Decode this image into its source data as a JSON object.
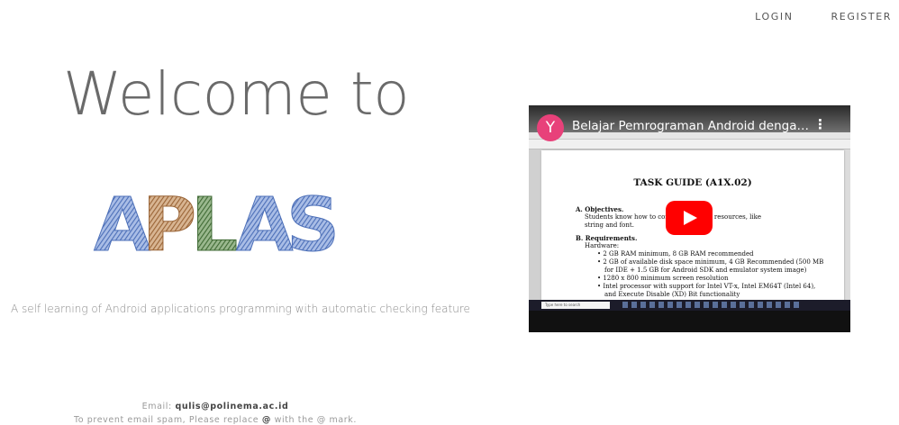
{
  "nav": {
    "login": "LOGIN",
    "register": "REGISTER"
  },
  "hero": {
    "welcome": "Welcome to",
    "logo_text": "APLAS",
    "logo_colors": [
      "#5b7fc4",
      "#b07a4a",
      "#4a7a3e",
      "#5b7fc4",
      "#5b7fc4"
    ],
    "tagline": "A self learning of Android applications programming with automatic checking feature"
  },
  "video": {
    "channel_initial": "Y",
    "title": "Belajar Pemrograman Android dengan A...",
    "more": "⋮",
    "doc": {
      "heading": "TASK GUIDE (A1X.02)",
      "sec_a_title": "A. Objectives.",
      "sec_a_line1": "Students know how to con        tudio project resources, like",
      "sec_a_line2": "string and font.",
      "sec_b_title": "B. Requirements.",
      "hardware": "Hardware:",
      "req1": "•  2 GB RAM minimum, 8 GB RAM recommended",
      "req2": "•  2 GB of available disk space minimum, 4 GB Recommended (500 MB",
      "req2b": "for IDE + 1.5 GB for Android SDK and emulator system image)",
      "req3": "•  1280 x 800 minimum screen resolution",
      "req4": "•  Intel processor with support for Intel VT-x, Intel EM64T (Intel 64),",
      "req4b": "and Execute Disable (XD) Bit functionality"
    },
    "taskbar_search": "Type here to search"
  },
  "footer": {
    "email_label": "Email: ",
    "email_value": "qulis@polinema.ac.id",
    "spam_prefix": "To prevent email spam, Please replace ",
    "spam_at": "@",
    "spam_suffix": " with the @ mark."
  }
}
